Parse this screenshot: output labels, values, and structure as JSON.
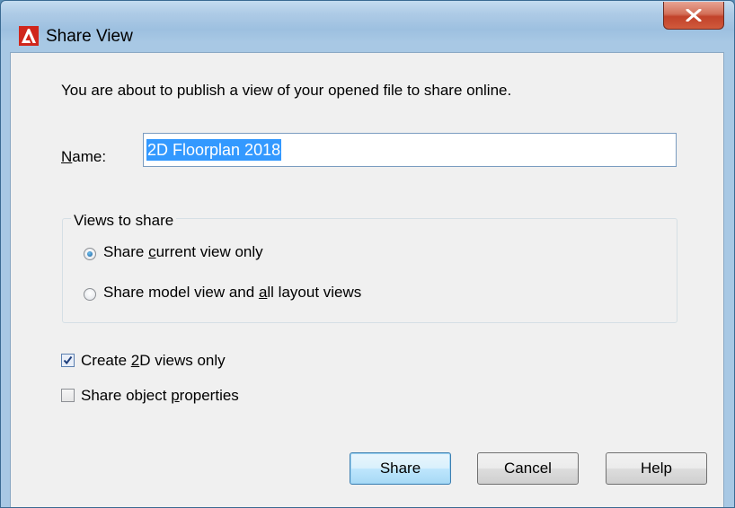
{
  "window": {
    "title": "Share View",
    "app_icon": "autocad-a-icon",
    "close_icon": "close-x-icon"
  },
  "intro_text": "You are about to publish a view of your opened file to share online.",
  "name_field": {
    "label_mnemonic": "N",
    "label_rest": "ame:",
    "value": "2D Floorplan 2018"
  },
  "views_group": {
    "title": "Views to share",
    "options": [
      {
        "pre": "Share ",
        "mnemonic": "c",
        "post": "urrent view only",
        "selected": true
      },
      {
        "pre": "Share model view and ",
        "mnemonic": "a",
        "post": "ll layout views",
        "selected": false
      }
    ]
  },
  "checkboxes": [
    {
      "pre": "Create ",
      "mnemonic": "2",
      "post": "D views only",
      "checked": true
    },
    {
      "pre": "Share object ",
      "mnemonic": "p",
      "post": "roperties",
      "checked": false
    }
  ],
  "buttons": {
    "share": "Share",
    "cancel": "Cancel",
    "help": "Help"
  },
  "colors": {
    "selection": "#3399ff",
    "close_button": "#c2422a",
    "app_icon_red": "#d0261c"
  }
}
